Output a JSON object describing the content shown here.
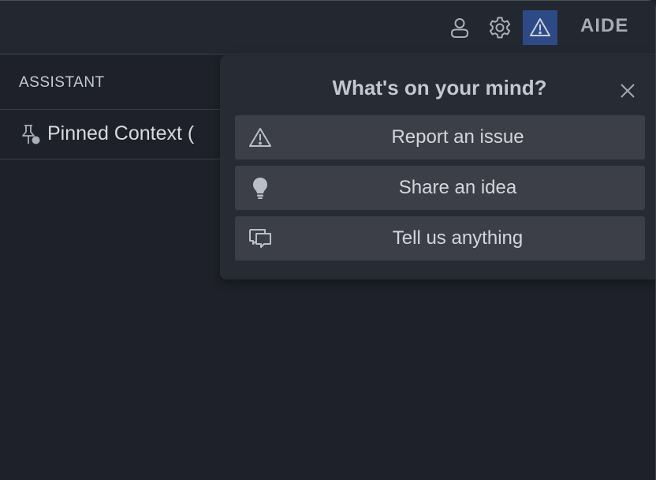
{
  "titlebar": {
    "app_name": "AIDE",
    "icons": [
      "account-icon",
      "gear-icon",
      "feedback-warning-icon"
    ]
  },
  "panel": {
    "title": "ASSISTANT",
    "pinned_label": "Pinned Context (",
    "pinned_icon": "pin-icon"
  },
  "popup": {
    "title": "What's on your mind?",
    "close_icon": "close-icon",
    "options": [
      {
        "label": "Report an issue",
        "icon": "warning-icon"
      },
      {
        "label": "Share an idea",
        "icon": "lightbulb-icon"
      },
      {
        "label": "Tell us anything",
        "icon": "chat-bubbles-icon"
      }
    ]
  },
  "colors": {
    "background": "#1e2129",
    "titlebar": "#232730",
    "accent_active": "#2e4a86",
    "popup": "#272b33",
    "option": "#3c3f48"
  }
}
